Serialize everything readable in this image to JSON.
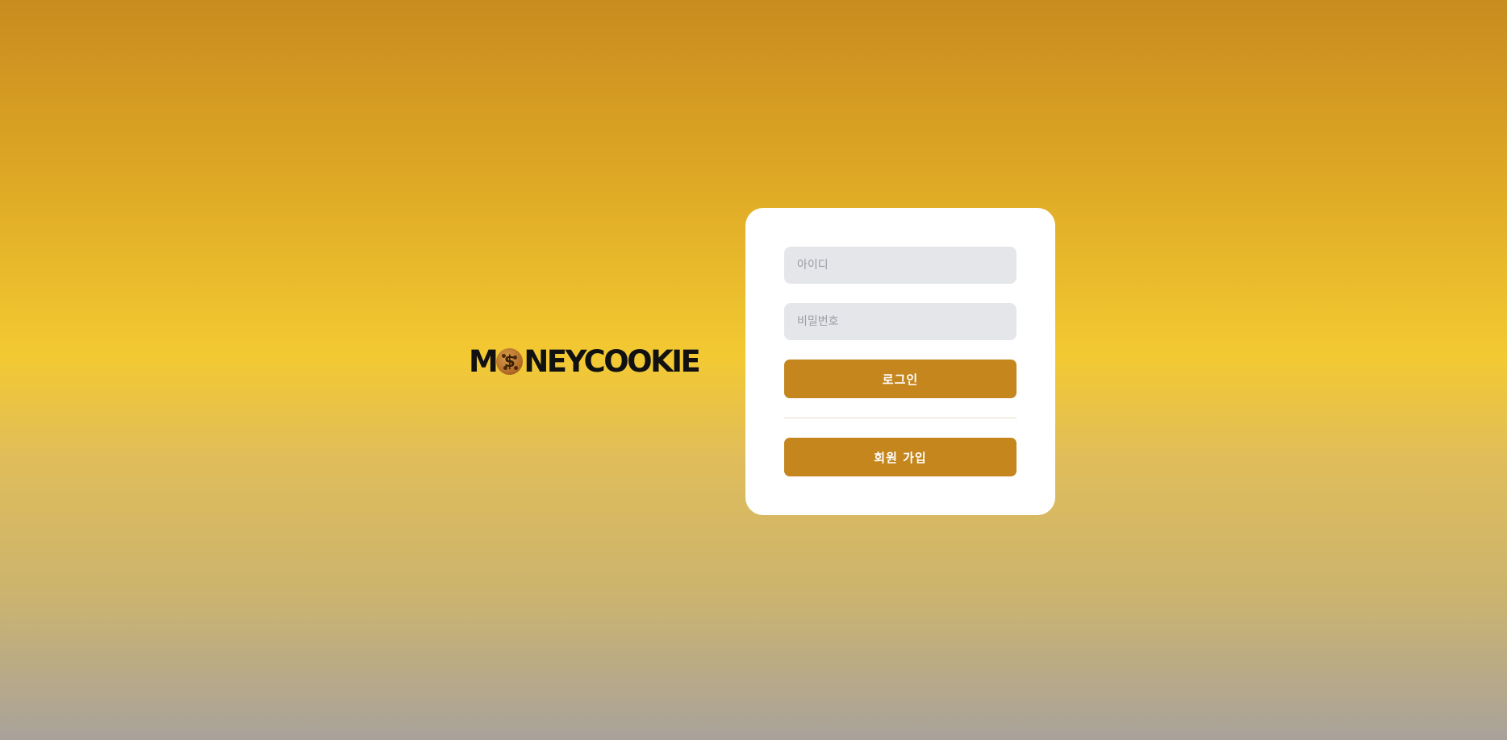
{
  "brand": {
    "logo_before": "M",
    "logo_coin_symbol": "$",
    "logo_after": "NEYCOOKIE"
  },
  "login_form": {
    "id_placeholder": "아이디",
    "id_value": "",
    "password_placeholder": "비밀번호",
    "password_value": "",
    "login_label": "로그인",
    "signup_label": "회원 가입"
  },
  "colors": {
    "accent": "#c4861d",
    "input_bg": "#e5e6ea",
    "card_bg": "#ffffff"
  }
}
